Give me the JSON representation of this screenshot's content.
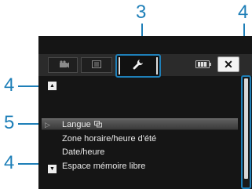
{
  "callouts": {
    "tab": "3",
    "scrollbar": "4",
    "up": "4",
    "selected": "5",
    "down": "4"
  },
  "tabs": {
    "camera_icon": "movie-camera-icon",
    "playback_icon": "playback-list-icon",
    "setup_icon": "wrench-icon"
  },
  "header": {
    "battery_icon": "battery-icon",
    "close_label": "✕"
  },
  "menu": {
    "up_label": "▲",
    "down_label": "▼",
    "items": [
      {
        "label": "Langue",
        "selected": true
      },
      {
        "label": "Zone horaire/heure d'été"
      },
      {
        "label": "Date/heure"
      },
      {
        "label": "Espace mémoire libre"
      }
    ]
  },
  "colors": {
    "callout": "#1e7fb8",
    "screen_bg": "#151515",
    "selection": "#5e5e5e"
  }
}
